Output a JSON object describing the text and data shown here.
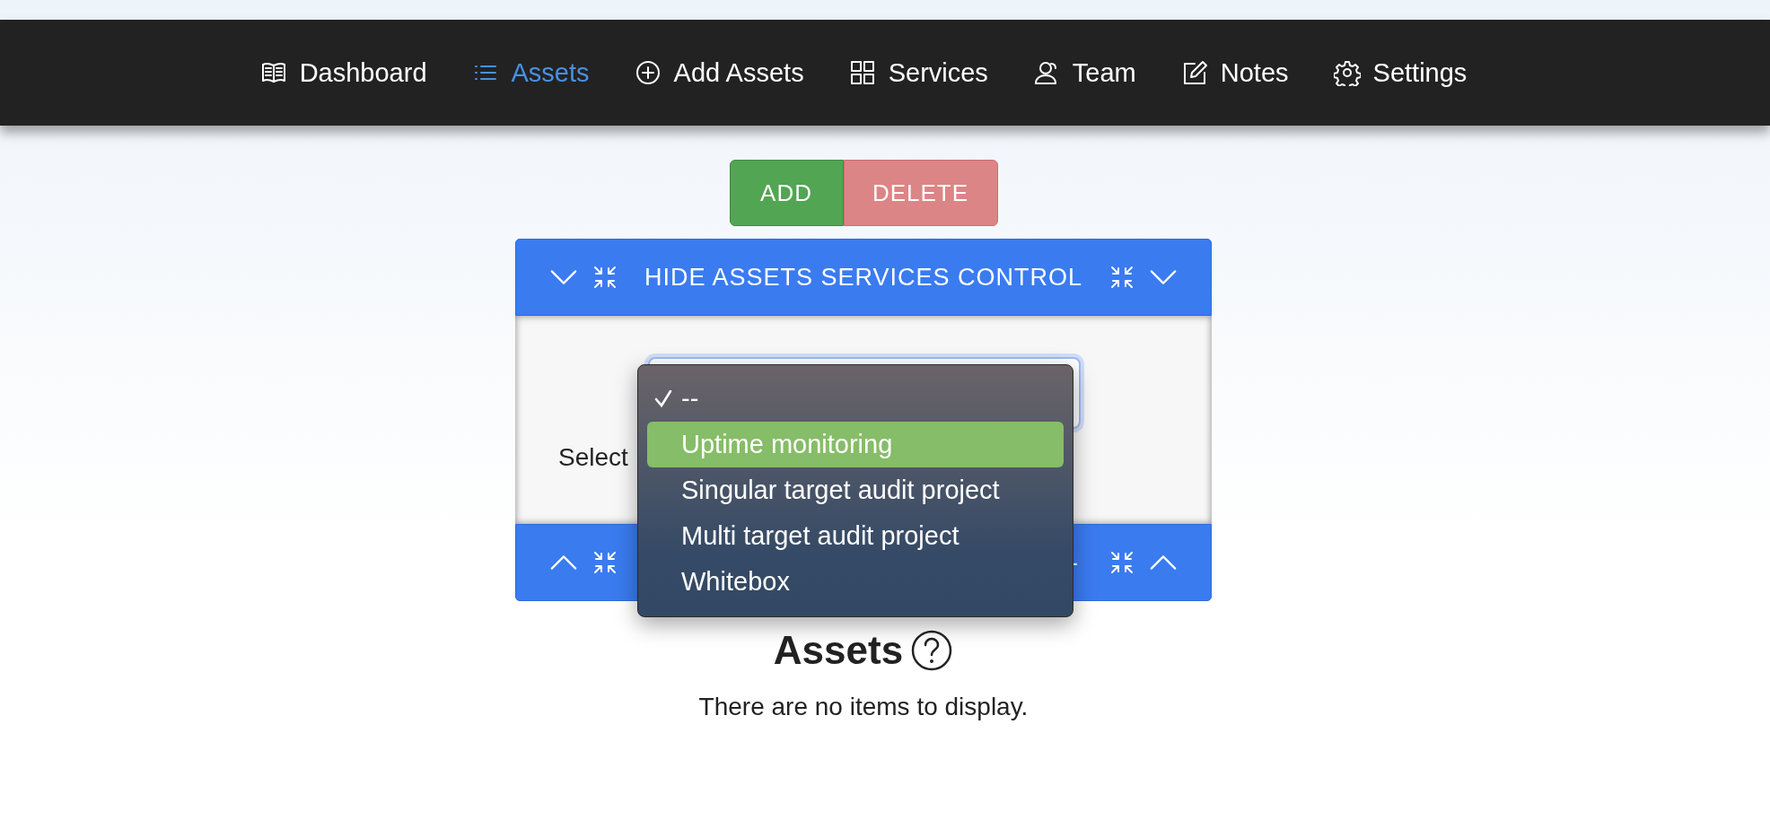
{
  "nav": {
    "items": [
      {
        "label": "Dashboard",
        "selected": false
      },
      {
        "label": "Assets",
        "selected": true
      },
      {
        "label": "Add Assets",
        "selected": false
      },
      {
        "label": "Services",
        "selected": false
      },
      {
        "label": "Team",
        "selected": false
      },
      {
        "label": "Notes",
        "selected": false
      },
      {
        "label": "Settings",
        "selected": false
      }
    ]
  },
  "actions": [
    {
      "label": "ADD",
      "kind": "add"
    },
    {
      "label": "DELETE",
      "kind": "delete"
    }
  ],
  "panel": {
    "header": "HIDE ASSETS SERVICES CONTROL",
    "footer_fragment": "-",
    "field_label": "Select",
    "dropdown": {
      "options": [
        {
          "label": "--",
          "checked": true,
          "highlighted": false
        },
        {
          "label": "Uptime monitoring",
          "checked": false,
          "highlighted": true
        },
        {
          "label": "Singular target audit project",
          "checked": false,
          "highlighted": false
        },
        {
          "label": "Multi target audit project",
          "checked": false,
          "highlighted": false
        },
        {
          "label": "Whitebox",
          "checked": false,
          "highlighted": false
        }
      ]
    }
  },
  "assets": {
    "title": "Assets",
    "empty_message": "There are no items to display."
  }
}
